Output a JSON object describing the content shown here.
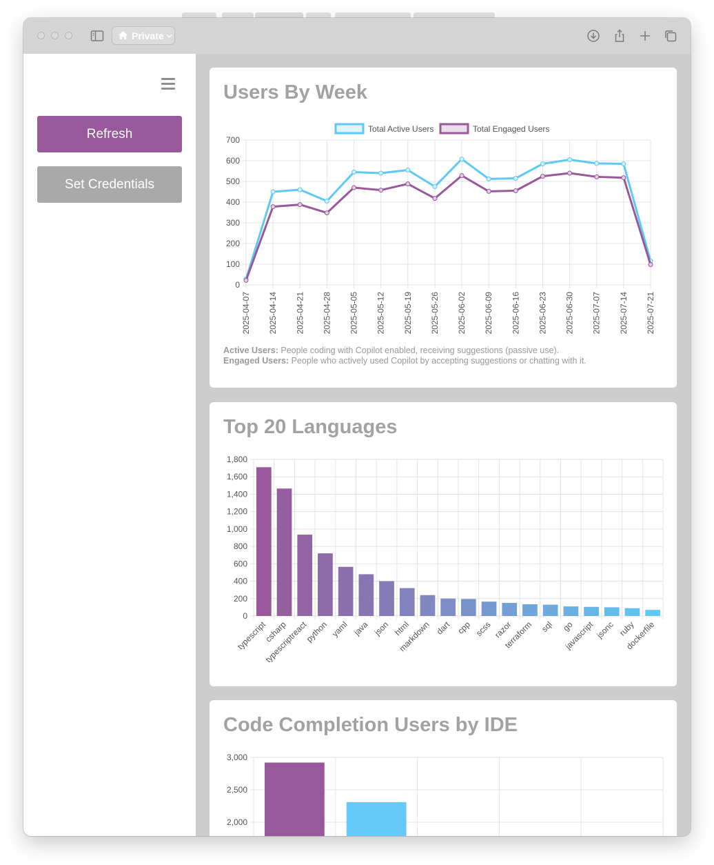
{
  "browser": {
    "private_label": "Private"
  },
  "sidebar": {
    "refresh_label": "Refresh",
    "credentials_label": "Set Credentials",
    "refresh_color": "#98589a",
    "credentials_color": "#a9a9a9"
  },
  "cards": {
    "users_by_week": {
      "title": "Users By Week",
      "note_active_term": "Active Users:",
      "note_active_text": " People coding with Copilot enabled, receiving suggestions (passive use).",
      "note_engaged_term": "Engaged Users:",
      "note_engaged_text": " People who actively used Copilot by accepting suggestions or chatting with it."
    },
    "top_languages": {
      "title": "Top 20 Languages"
    },
    "ide_users": {
      "title": "Code Completion Users by IDE"
    }
  },
  "chart_data": [
    {
      "type": "line",
      "title": "Users By Week",
      "x": [
        "2025-04-07",
        "2025-04-14",
        "2025-04-21",
        "2025-04-28",
        "2025-05-05",
        "2025-05-12",
        "2025-05-19",
        "2025-05-26",
        "2025-06-02",
        "2025-06-09",
        "2025-06-16",
        "2025-06-23",
        "2025-06-30",
        "2025-07-07",
        "2025-07-14",
        "2025-07-21"
      ],
      "series": [
        {
          "name": "Total Active Users",
          "color": "#5ec8f6",
          "values": [
            28,
            450,
            460,
            405,
            545,
            540,
            555,
            475,
            608,
            512,
            515,
            585,
            605,
            587,
            585,
            115
          ]
        },
        {
          "name": "Total Engaged Users",
          "color": "#98589a",
          "values": [
            22,
            378,
            388,
            348,
            470,
            458,
            488,
            418,
            528,
            452,
            455,
            525,
            540,
            522,
            518,
            98
          ]
        }
      ],
      "ylim": [
        0,
        700
      ],
      "yticks": [
        0,
        100,
        200,
        300,
        400,
        500,
        600,
        700
      ],
      "legend": "top-center",
      "grid": true
    },
    {
      "type": "bar",
      "title": "Top 20 Languages",
      "categories": [
        "typescript",
        "csharp",
        "typescriptreact",
        "python",
        "yaml",
        "java",
        "json",
        "html",
        "markdown",
        "dart",
        "cpp",
        "scss",
        "razor",
        "terraform",
        "sql",
        "go",
        "javascript",
        "jsonc",
        "ruby",
        "dockerfile"
      ],
      "values": [
        1710,
        1465,
        935,
        720,
        565,
        480,
        400,
        320,
        240,
        200,
        195,
        165,
        150,
        135,
        130,
        110,
        105,
        100,
        90,
        70
      ],
      "ylim": [
        0,
        1800
      ],
      "yticks": [
        "0",
        "200",
        "400",
        "600",
        "800",
        "1,000",
        "1,200",
        "1,400",
        "1,600",
        "1,800"
      ],
      "color_start": "#98589a",
      "color_end": "#5ec8f6",
      "grid": true
    },
    {
      "type": "bar",
      "title": "Code Completion Users by IDE",
      "values": [
        2920,
        2310
      ],
      "colors": [
        "#98589a",
        "#66c9fb"
      ],
      "visible_yticks": [
        "2,000",
        "2,500",
        "3,000"
      ],
      "grid": true
    }
  ]
}
